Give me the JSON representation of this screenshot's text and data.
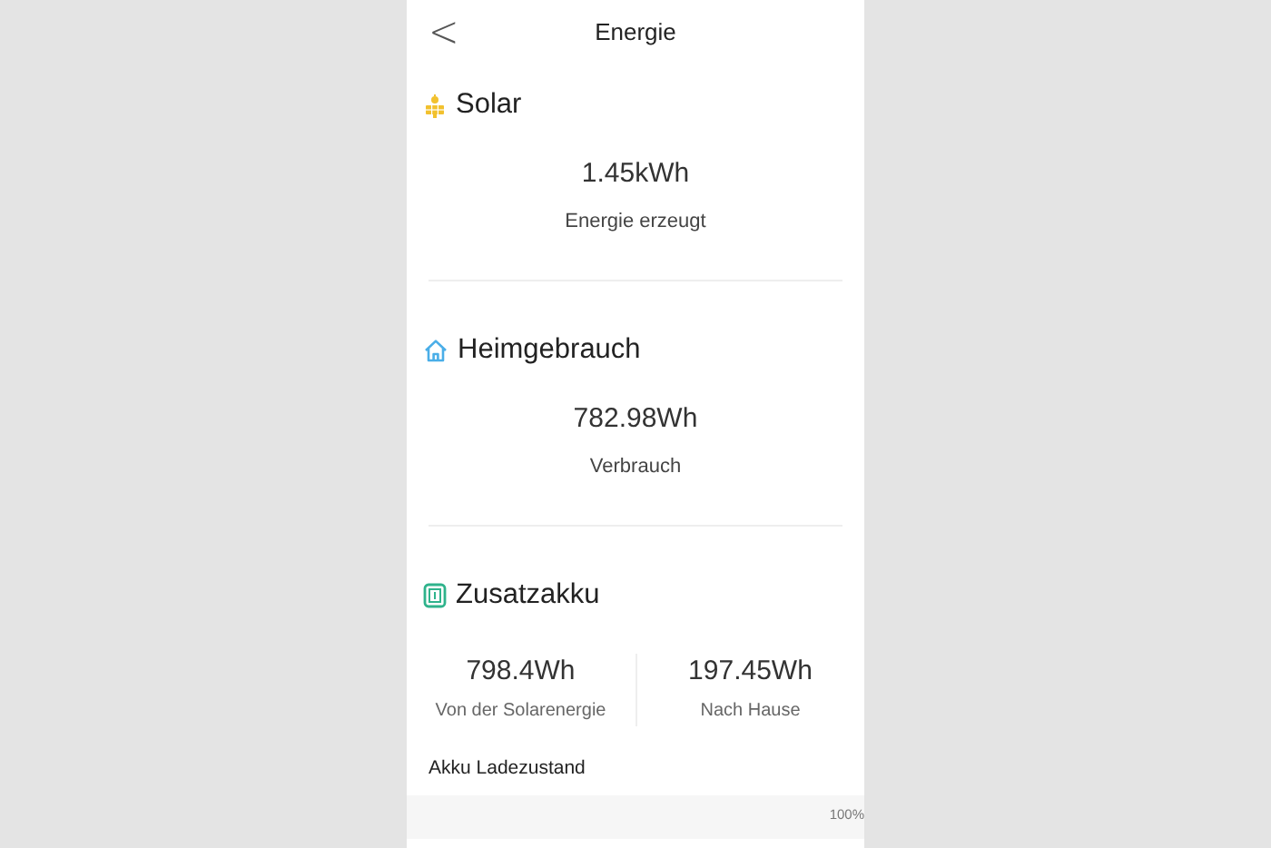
{
  "header": {
    "back": "<",
    "title": "Energie"
  },
  "sections": [
    {
      "kind": "single",
      "title": "Solar",
      "stats": [
        {
          "value": "1.45kWh",
          "label": "Energie erzeugt"
        }
      ]
    },
    {
      "kind": "single",
      "title": "Heimgebrauch",
      "stats": [
        {
          "value": "782.98Wh",
          "label": "Verbrauch"
        }
      ]
    },
    {
      "kind": "split",
      "title": "Zusatzakku",
      "stats": [
        {
          "value": "798.4Wh",
          "label": "Von der Solarenergie"
        },
        {
          "value": "197.45Wh",
          "label": "Nach Hause"
        }
      ],
      "subheading": "Akku Ladezustand",
      "axis_label": "100%"
    }
  ]
}
